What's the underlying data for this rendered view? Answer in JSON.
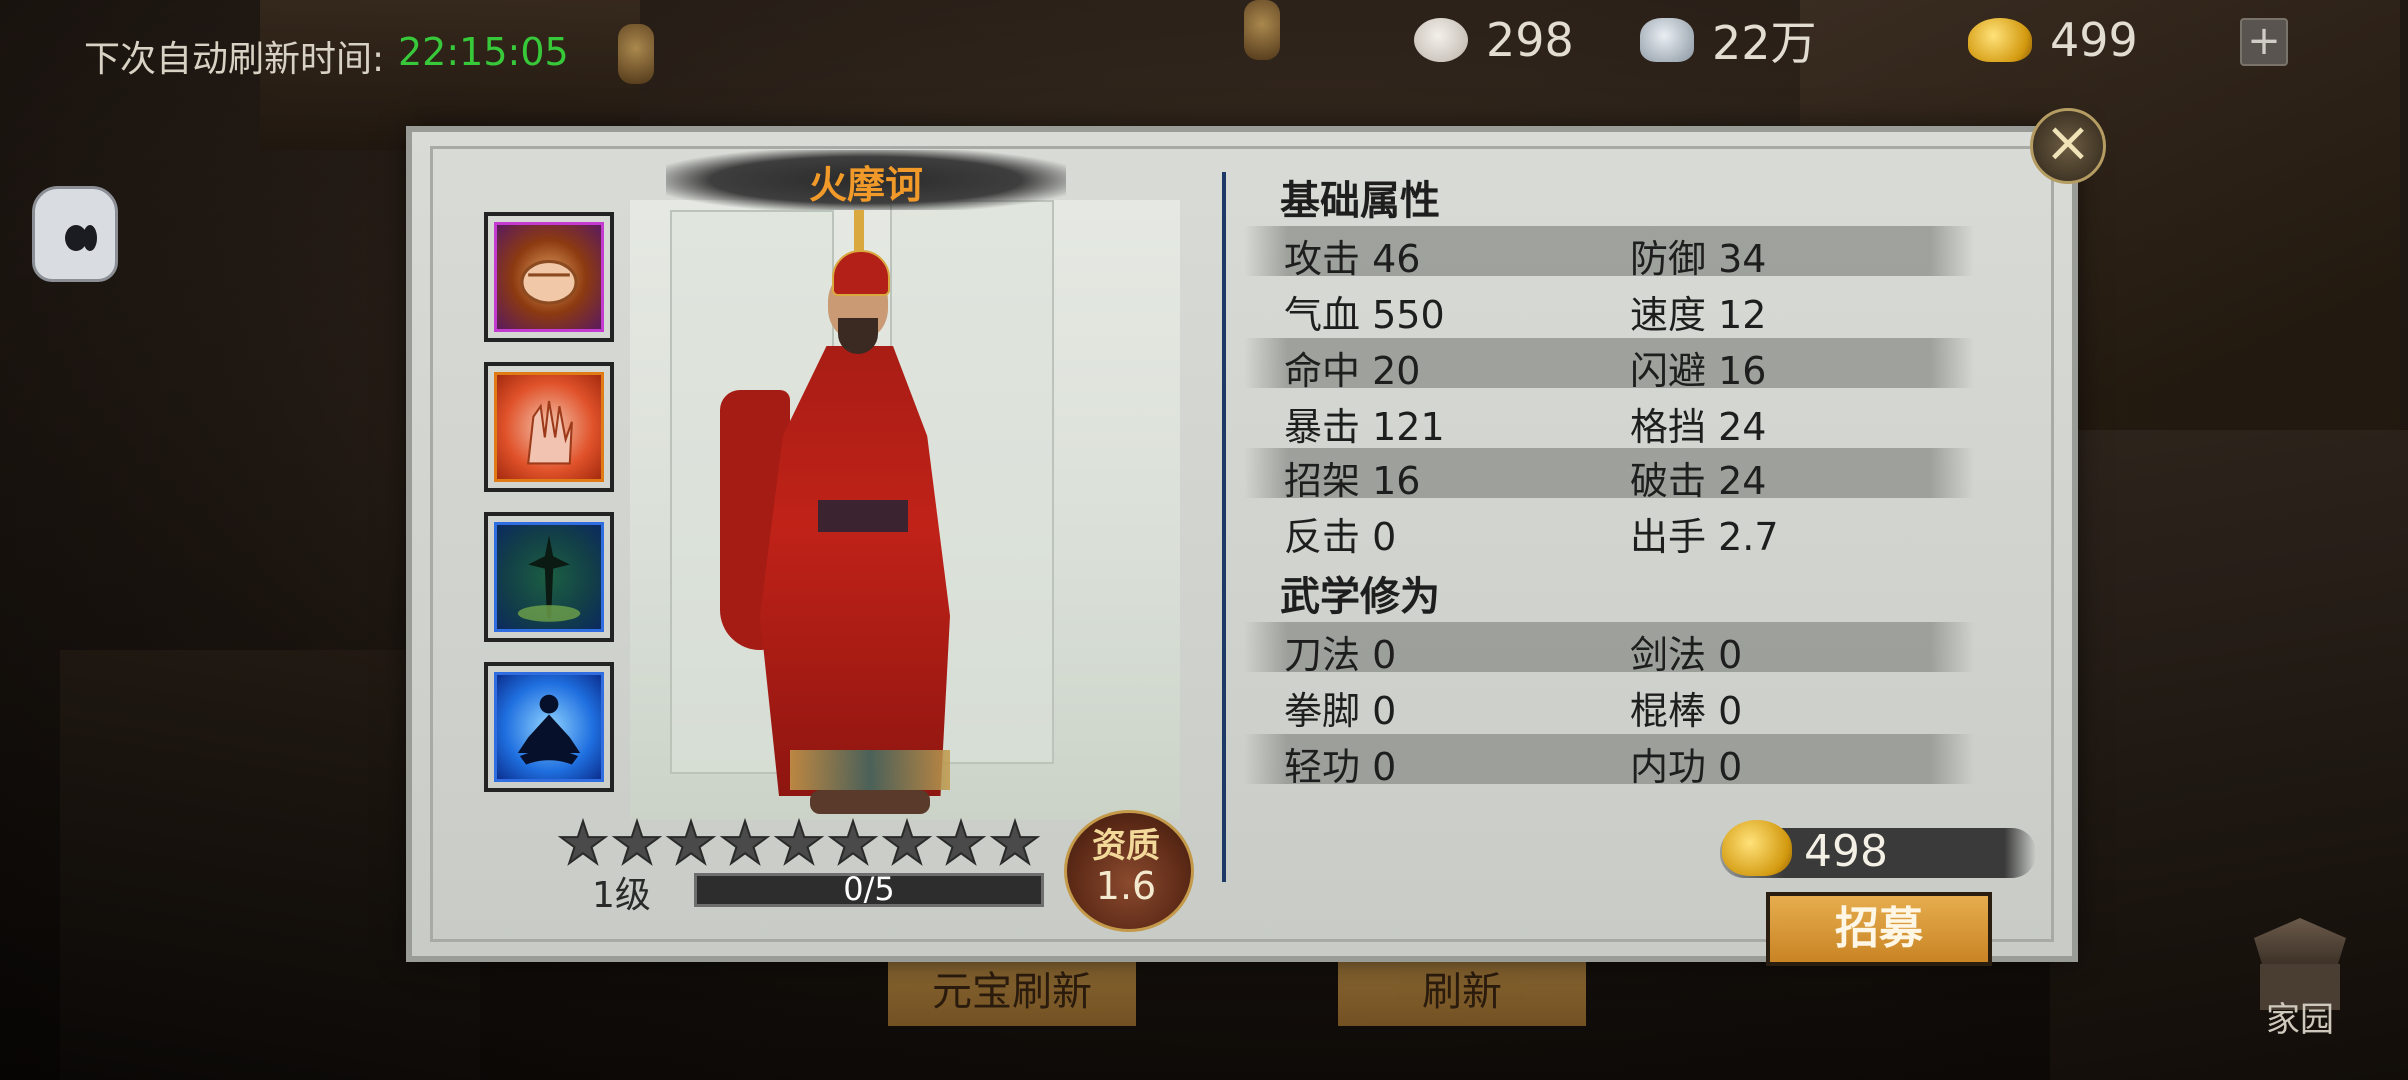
{
  "top_bar": {
    "refresh_label": "下次自动刷新时间:",
    "refresh_time": "22:15:05",
    "resources": [
      {
        "icon": "bun-icon",
        "value": "298"
      },
      {
        "icon": "silver-ingot-icon",
        "value": "22万"
      },
      {
        "icon": "gold-ingot-icon",
        "value": "499"
      }
    ],
    "add_button": "+"
  },
  "hero": {
    "name": "火摩诃",
    "level": "1级",
    "exp_text": "0/5",
    "exp_progress": 0.0,
    "stars_total": 9,
    "aptitude_label": "资质",
    "aptitude_value": "1.6",
    "skills": [
      "fist-skill-icon",
      "palm-skill-icon",
      "blade-grass-skill-icon",
      "meditation-skill-icon"
    ]
  },
  "basic_attrs": {
    "title": "基础属性",
    "rows": [
      [
        {
          "name": "攻击",
          "value": "46"
        },
        {
          "name": "防御",
          "value": "34"
        }
      ],
      [
        {
          "name": "气血",
          "value": "550"
        },
        {
          "name": "速度",
          "value": "12"
        }
      ],
      [
        {
          "name": "命中",
          "value": "20"
        },
        {
          "name": "闪避",
          "value": "16"
        }
      ],
      [
        {
          "name": "暴击",
          "value": "121"
        },
        {
          "name": "格挡",
          "value": "24"
        }
      ],
      [
        {
          "name": "招架",
          "value": "16"
        },
        {
          "name": "破击",
          "value": "24"
        }
      ],
      [
        {
          "name": "反击",
          "value": "0"
        },
        {
          "name": "出手",
          "value": "2.7"
        }
      ]
    ]
  },
  "martial_attrs": {
    "title": "武学修为",
    "rows": [
      [
        {
          "name": "刀法",
          "value": "0"
        },
        {
          "name": "剑法",
          "value": "0"
        }
      ],
      [
        {
          "name": "拳脚",
          "value": "0"
        },
        {
          "name": "棍棒",
          "value": "0"
        }
      ],
      [
        {
          "name": "轻功",
          "value": "0"
        },
        {
          "name": "内功",
          "value": "0"
        }
      ]
    ]
  },
  "recruit": {
    "cost": "498",
    "button_label": "招募"
  },
  "bottom": {
    "yuanbao_refresh": "元宝刷新",
    "refresh": "刷新",
    "home": "家园"
  },
  "close_label": "×",
  "colors": {
    "timer_green": "#37c93a",
    "hero_name_orange": "#f19a2a",
    "button_gold": "#c98424"
  }
}
